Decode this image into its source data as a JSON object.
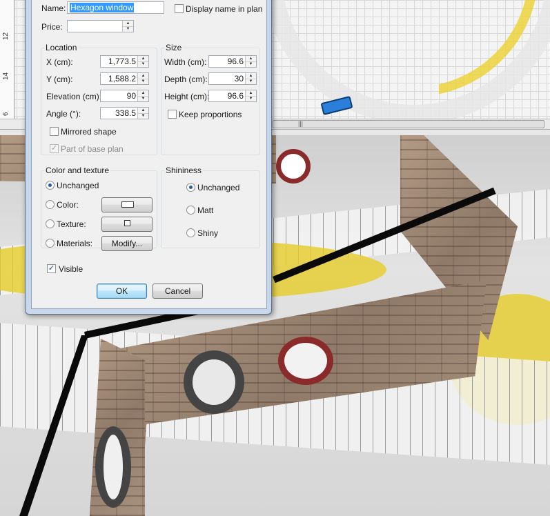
{
  "plan": {
    "ruler_labels": [
      "12",
      "14",
      "6"
    ]
  },
  "dialog": {
    "name": {
      "label": "Name:",
      "value": "Hexagon window"
    },
    "display_name_in_plan": {
      "label": "Display name in plan",
      "checked": false
    },
    "price": {
      "label": "Price:",
      "value": ""
    },
    "location": {
      "title": "Location",
      "x": {
        "label": "X (cm):",
        "value": "1,773.5"
      },
      "y": {
        "label": "Y (cm):",
        "value": "1,588.2"
      },
      "elevation": {
        "label": "Elevation (cm):",
        "value": "90"
      },
      "angle": {
        "label": "Angle (°):",
        "value": "338.5"
      },
      "mirrored": {
        "label": "Mirrored shape",
        "checked": false
      },
      "base_plan": {
        "label": "Part of base plan",
        "checked": true,
        "enabled": false
      }
    },
    "size": {
      "title": "Size",
      "width": {
        "label": "Width (cm):",
        "value": "96.6"
      },
      "depth": {
        "label": "Depth (cm):",
        "value": "30"
      },
      "height": {
        "label": "Height (cm):",
        "value": "96.6"
      },
      "keep_proportions": {
        "label": "Keep proportions",
        "checked": false
      }
    },
    "color_texture": {
      "title": "Color and texture",
      "unchanged": {
        "label": "Unchanged",
        "checked": true
      },
      "color": {
        "label": "Color:"
      },
      "texture": {
        "label": "Texture:"
      },
      "materials": {
        "label": "Materials:",
        "button": "Modify..."
      }
    },
    "shininess": {
      "title": "Shininess",
      "unchanged": {
        "label": "Unchanged",
        "checked": true
      },
      "matt": {
        "label": "Matt"
      },
      "shiny": {
        "label": "Shiny"
      }
    },
    "visible": {
      "label": "Visible",
      "checked": true
    },
    "ok_label": "OK",
    "cancel_label": "Cancel"
  },
  "colors": {
    "selection": "#3399ff",
    "window_frame": "#8a2a2a",
    "wall_stone": "#a08a78",
    "ruler_yellow": "#e6cd28"
  }
}
